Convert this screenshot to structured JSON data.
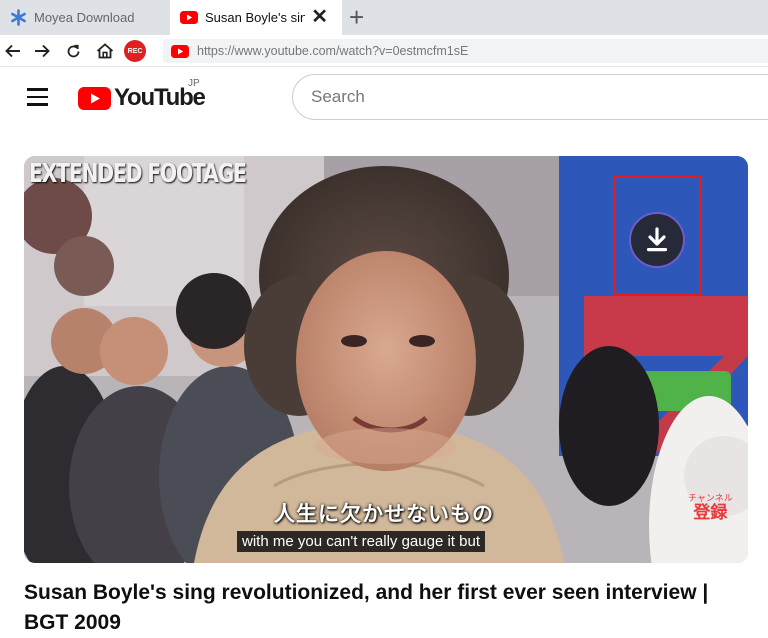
{
  "browser": {
    "tabs": [
      {
        "title": "Moyea Downloader",
        "active": false,
        "icon": "moyea-asterisk-icon"
      },
      {
        "title": "Susan Boyle's sing",
        "active": true,
        "icon": "youtube-favicon"
      }
    ],
    "close_glyph": "✕",
    "new_tab_glyph": "+",
    "nav": {
      "back": "back-arrow-icon",
      "forward": "forward-arrow-icon",
      "reload": "reload-icon",
      "home": "home-icon",
      "record_label": "REC"
    },
    "url": "https://www.youtube.com/watch?v=0estmcfm1sE"
  },
  "youtube": {
    "logo_text": "YouTube",
    "region": "JP",
    "search_placeholder": "Search"
  },
  "video": {
    "overlay_caption": "EXTENDED FOOTAGE",
    "subtitle_jp": "人生に欠かせないもの",
    "subtitle_en": "with me you can't really gauge it but",
    "watermark_small": "チャンネル",
    "watermark_big": "登録",
    "download_button_icon": "download-icon"
  },
  "title": "Susan Boyle's sing revolutionized, and her first ever seen interview | BGT 2009",
  "colors": {
    "youtube_red": "#ff0000",
    "highlight_red": "#e61b1b",
    "download_ring": "#6f5cc9",
    "tabbar_bg": "#dee1e6"
  }
}
